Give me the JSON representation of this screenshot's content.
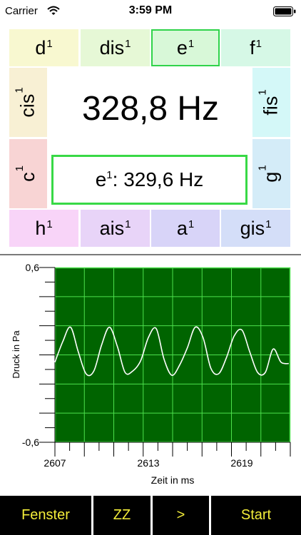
{
  "status": {
    "carrier": "Carrier",
    "time": "3:59 PM"
  },
  "tuner": {
    "notes": {
      "d": {
        "base": "d",
        "octave": "1"
      },
      "dis": {
        "base": "dis",
        "octave": "1"
      },
      "e": {
        "base": "e",
        "octave": "1"
      },
      "f": {
        "base": "f",
        "octave": "1"
      },
      "cis": {
        "base": "cis",
        "octave": "1"
      },
      "fis": {
        "base": "fis",
        "octave": "1"
      },
      "c": {
        "base": "c",
        "octave": "1"
      },
      "g": {
        "base": "g",
        "octave": "1"
      },
      "h": {
        "base": "h",
        "octave": "1"
      },
      "ais": {
        "base": "ais",
        "octave": "1"
      },
      "a": {
        "base": "a",
        "octave": "1"
      },
      "gis": {
        "base": "gis",
        "octave": "1"
      }
    },
    "selected_note": "e1",
    "measured_frequency": "328,8 Hz",
    "target": {
      "base": "e",
      "octave": "1",
      "value": ": 329,6 Hz"
    },
    "colors": {
      "d": "#f8f8d0",
      "dis": "#e6f8d6",
      "e": "#d8f8d8",
      "f": "#d6f8e6",
      "cis": "#f8f0d4",
      "fis": "#d4f8f8",
      "c": "#f8d4d4",
      "g": "#d4ecf8",
      "h": "#f8d4f8",
      "ais": "#e8d4f8",
      "a": "#d8d4f8",
      "gis": "#d4def8",
      "selected_border": "#2fd34a"
    }
  },
  "chart_data": {
    "type": "line",
    "xlabel": "Zeit in ms",
    "ylabel": "Druck in Pa",
    "x_ticks": [
      "2607",
      "2613",
      "2619"
    ],
    "y_ticks": [
      "0,6",
      "-0,6"
    ],
    "xlim": [
      2607,
      2622.1
    ],
    "ylim": [
      -0.6,
      0.6
    ],
    "frequency_hz": 328.8,
    "grid": true,
    "plot_bg": "#006400",
    "grid_color": "#4ce04c",
    "line_color": "#ffffff",
    "series": [
      {
        "x": [
          2607.0,
          2607.5,
          2608.0,
          2608.5,
          2609.0,
          2609.5,
          2610.0,
          2610.5,
          2611.0,
          2611.5,
          2612.0,
          2612.5,
          2613.0,
          2613.5,
          2614.0,
          2614.5,
          2615.0,
          2615.5,
          2616.0,
          2616.5,
          2617.0,
          2617.5,
          2618.0,
          2618.5,
          2619.0,
          2619.5,
          2620.0,
          2620.5,
          2621.0,
          2621.5,
          2622.0
        ],
        "y": [
          -0.05,
          0.09,
          0.19,
          0.02,
          -0.13,
          -0.11,
          0.07,
          0.19,
          0.06,
          -0.12,
          -0.11,
          -0.04,
          0.12,
          0.18,
          -0.03,
          -0.14,
          -0.07,
          0.05,
          0.19,
          0.12,
          -0.09,
          -0.13,
          -0.02,
          0.13,
          0.17,
          0.02,
          -0.12,
          -0.12,
          0.04,
          -0.05,
          -0.06
        ]
      }
    ]
  },
  "toolbar": {
    "window": "Fenster",
    "zz": "ZZ",
    "next": ">",
    "start": "Start"
  }
}
